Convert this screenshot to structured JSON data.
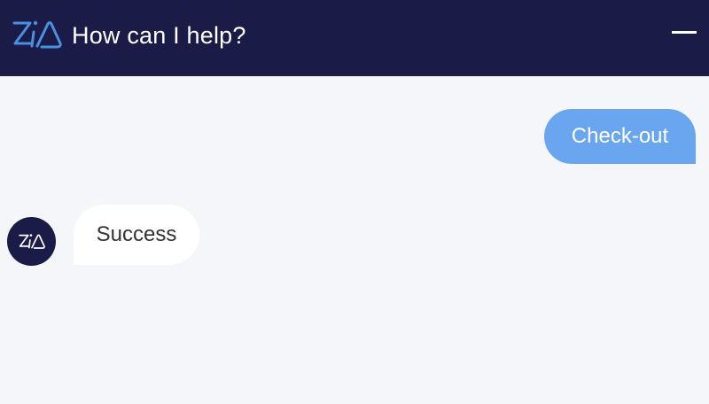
{
  "header": {
    "title": "How can I help?",
    "logo_icon": "zia-logo-icon",
    "minimize_icon": "minimize-icon"
  },
  "messages": [
    {
      "sender": "user",
      "text": "Check-out"
    },
    {
      "sender": "bot",
      "text": "Success",
      "avatar_icon": "zia-avatar-icon"
    }
  ],
  "colors": {
    "header_bg": "#1b1b48",
    "accent": "#4a90e2",
    "user_bubble": "#6aa6f0",
    "bot_bubble": "#ffffff",
    "chat_bg": "#f5f6fa"
  }
}
